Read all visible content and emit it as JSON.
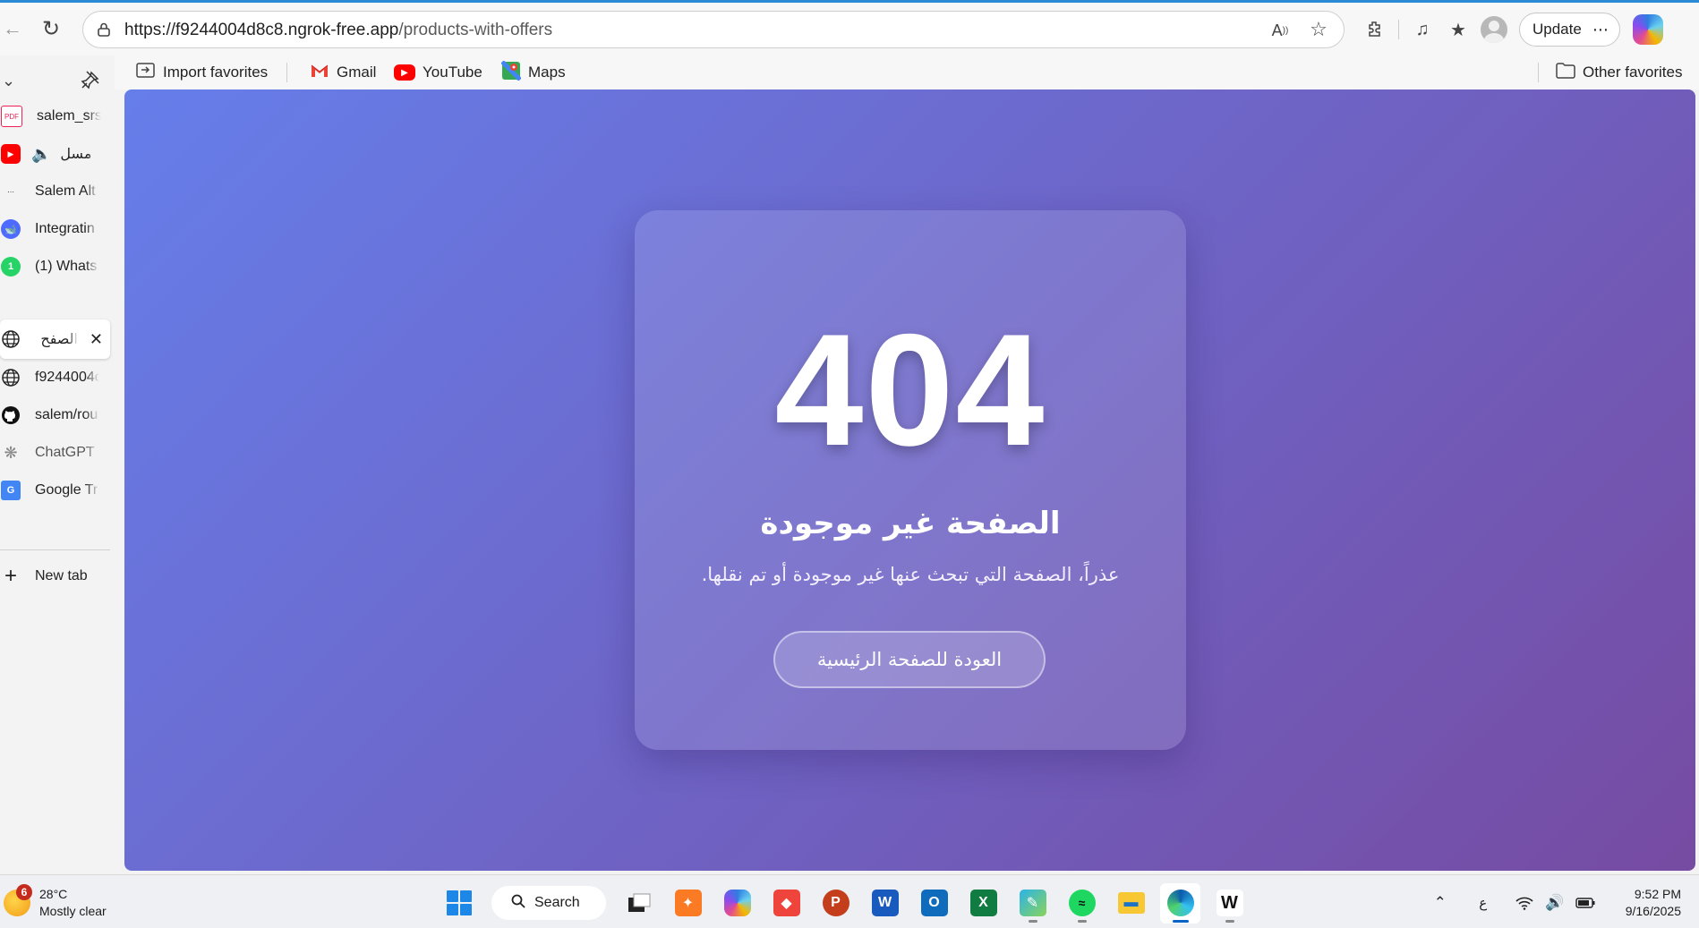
{
  "browser": {
    "url_host": "https://f9244004d8c8.ngrok-free.app",
    "url_path": "/products-with-offers",
    "update_label": "Update",
    "more_label": "⋯"
  },
  "favorites": {
    "import_label": "Import favorites",
    "items": [
      {
        "label": "Gmail"
      },
      {
        "label": "YouTube"
      },
      {
        "label": "Maps"
      }
    ],
    "other_label": "Other favorites"
  },
  "sidebar": {
    "tabs": [
      {
        "label": "salem_srs"
      },
      {
        "label": "مسل"
      },
      {
        "label": "Salem Alt"
      },
      {
        "label": "Integratin"
      },
      {
        "label": "(1) Whats"
      },
      {
        "label": "الصفح"
      },
      {
        "label": "f9244004c"
      },
      {
        "label": "salem/rou"
      },
      {
        "label": "ChatGPT"
      },
      {
        "label": "Google Tr"
      }
    ],
    "new_tab_label": "New tab"
  },
  "page": {
    "code": "404",
    "title": "الصفحة غير موجودة",
    "message": "عذراً، الصفحة التي تبحث عنها غير موجودة أو تم نقلها.",
    "home_button": "العودة للصفحة الرئيسية",
    "gradient_start": "#667eea",
    "gradient_end": "#764ba2"
  },
  "taskbar": {
    "weather_badge": "6",
    "temperature": "28°C",
    "condition": "Mostly clear",
    "search_label": "Search",
    "language": "ع",
    "time": "9:52 PM",
    "date": "9/16/2025"
  }
}
